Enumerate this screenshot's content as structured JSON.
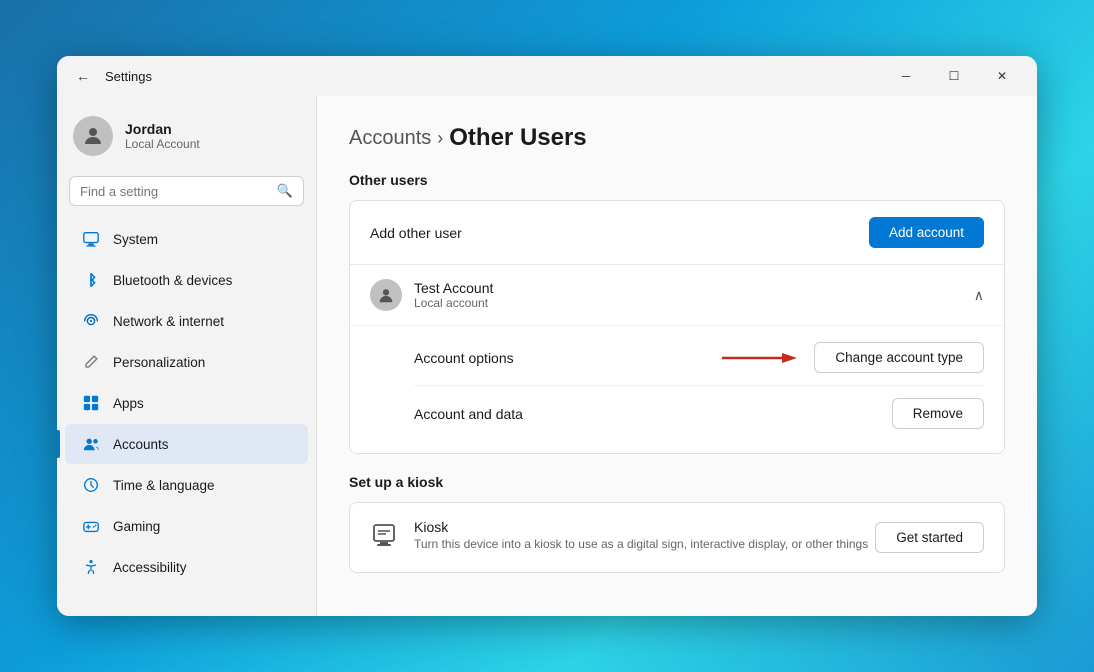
{
  "window": {
    "title": "Settings",
    "minimize_label": "─",
    "maximize_label": "☐",
    "close_label": "✕",
    "back_label": "←"
  },
  "sidebar": {
    "user": {
      "name": "Jordan",
      "account_type": "Local Account"
    },
    "search": {
      "placeholder": "Find a setting"
    },
    "nav_items": [
      {
        "id": "system",
        "label": "System",
        "icon": "🖥️"
      },
      {
        "id": "bluetooth",
        "label": "Bluetooth & devices",
        "icon": "🔵"
      },
      {
        "id": "network",
        "label": "Network & internet",
        "icon": "🛡️"
      },
      {
        "id": "personalization",
        "label": "Personalization",
        "icon": "✏️"
      },
      {
        "id": "apps",
        "label": "Apps",
        "icon": "📦"
      },
      {
        "id": "accounts",
        "label": "Accounts",
        "icon": "👤",
        "active": true
      },
      {
        "id": "time",
        "label": "Time & language",
        "icon": "🕐"
      },
      {
        "id": "gaming",
        "label": "Gaming",
        "icon": "🎮"
      },
      {
        "id": "accessibility",
        "label": "Accessibility",
        "icon": "♿"
      }
    ]
  },
  "main": {
    "breadcrumb_parent": "Accounts",
    "breadcrumb_chevron": "›",
    "breadcrumb_current": "Other Users",
    "other_users_section": {
      "title": "Other users",
      "add_user_label": "Add other user",
      "add_account_button": "Add account",
      "test_account": {
        "name": "Test Account",
        "type": "Local account",
        "account_options_label": "Account options",
        "change_account_type_button": "Change account type",
        "account_data_label": "Account and data",
        "remove_button": "Remove"
      }
    },
    "kiosk_section": {
      "title": "Set up a kiosk",
      "kiosk_title": "Kiosk",
      "kiosk_description": "Turn this device into a kiosk to use as a digital sign, interactive display, or other things",
      "get_started_button": "Get started"
    }
  }
}
